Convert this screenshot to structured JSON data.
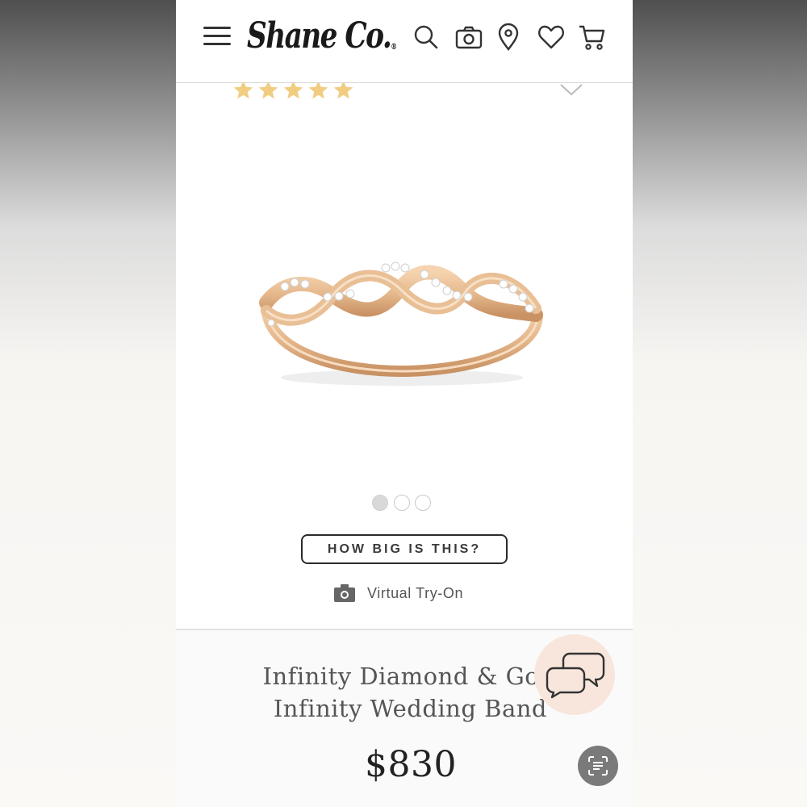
{
  "header": {
    "logo_text": "Shane Co.",
    "logo_mark": "®",
    "icons": [
      "menu-icon",
      "search-icon",
      "camera-icon",
      "location-pin-icon",
      "heart-icon",
      "cart-icon"
    ]
  },
  "product": {
    "rating_stars": 5,
    "gallery_dots": 3,
    "active_dot": 1,
    "size_button": "HOW BIG IS THIS?",
    "virtual_try_on": "Virtual Try-On",
    "title_line1": "Infinity Diamond & Gol",
    "title_line2": "Infinity Wedding Band",
    "price": "$830"
  },
  "colors": {
    "star": "#f1cd82",
    "ring_gold": "#e6b98d",
    "chat_bg": "#f8e6dc"
  }
}
